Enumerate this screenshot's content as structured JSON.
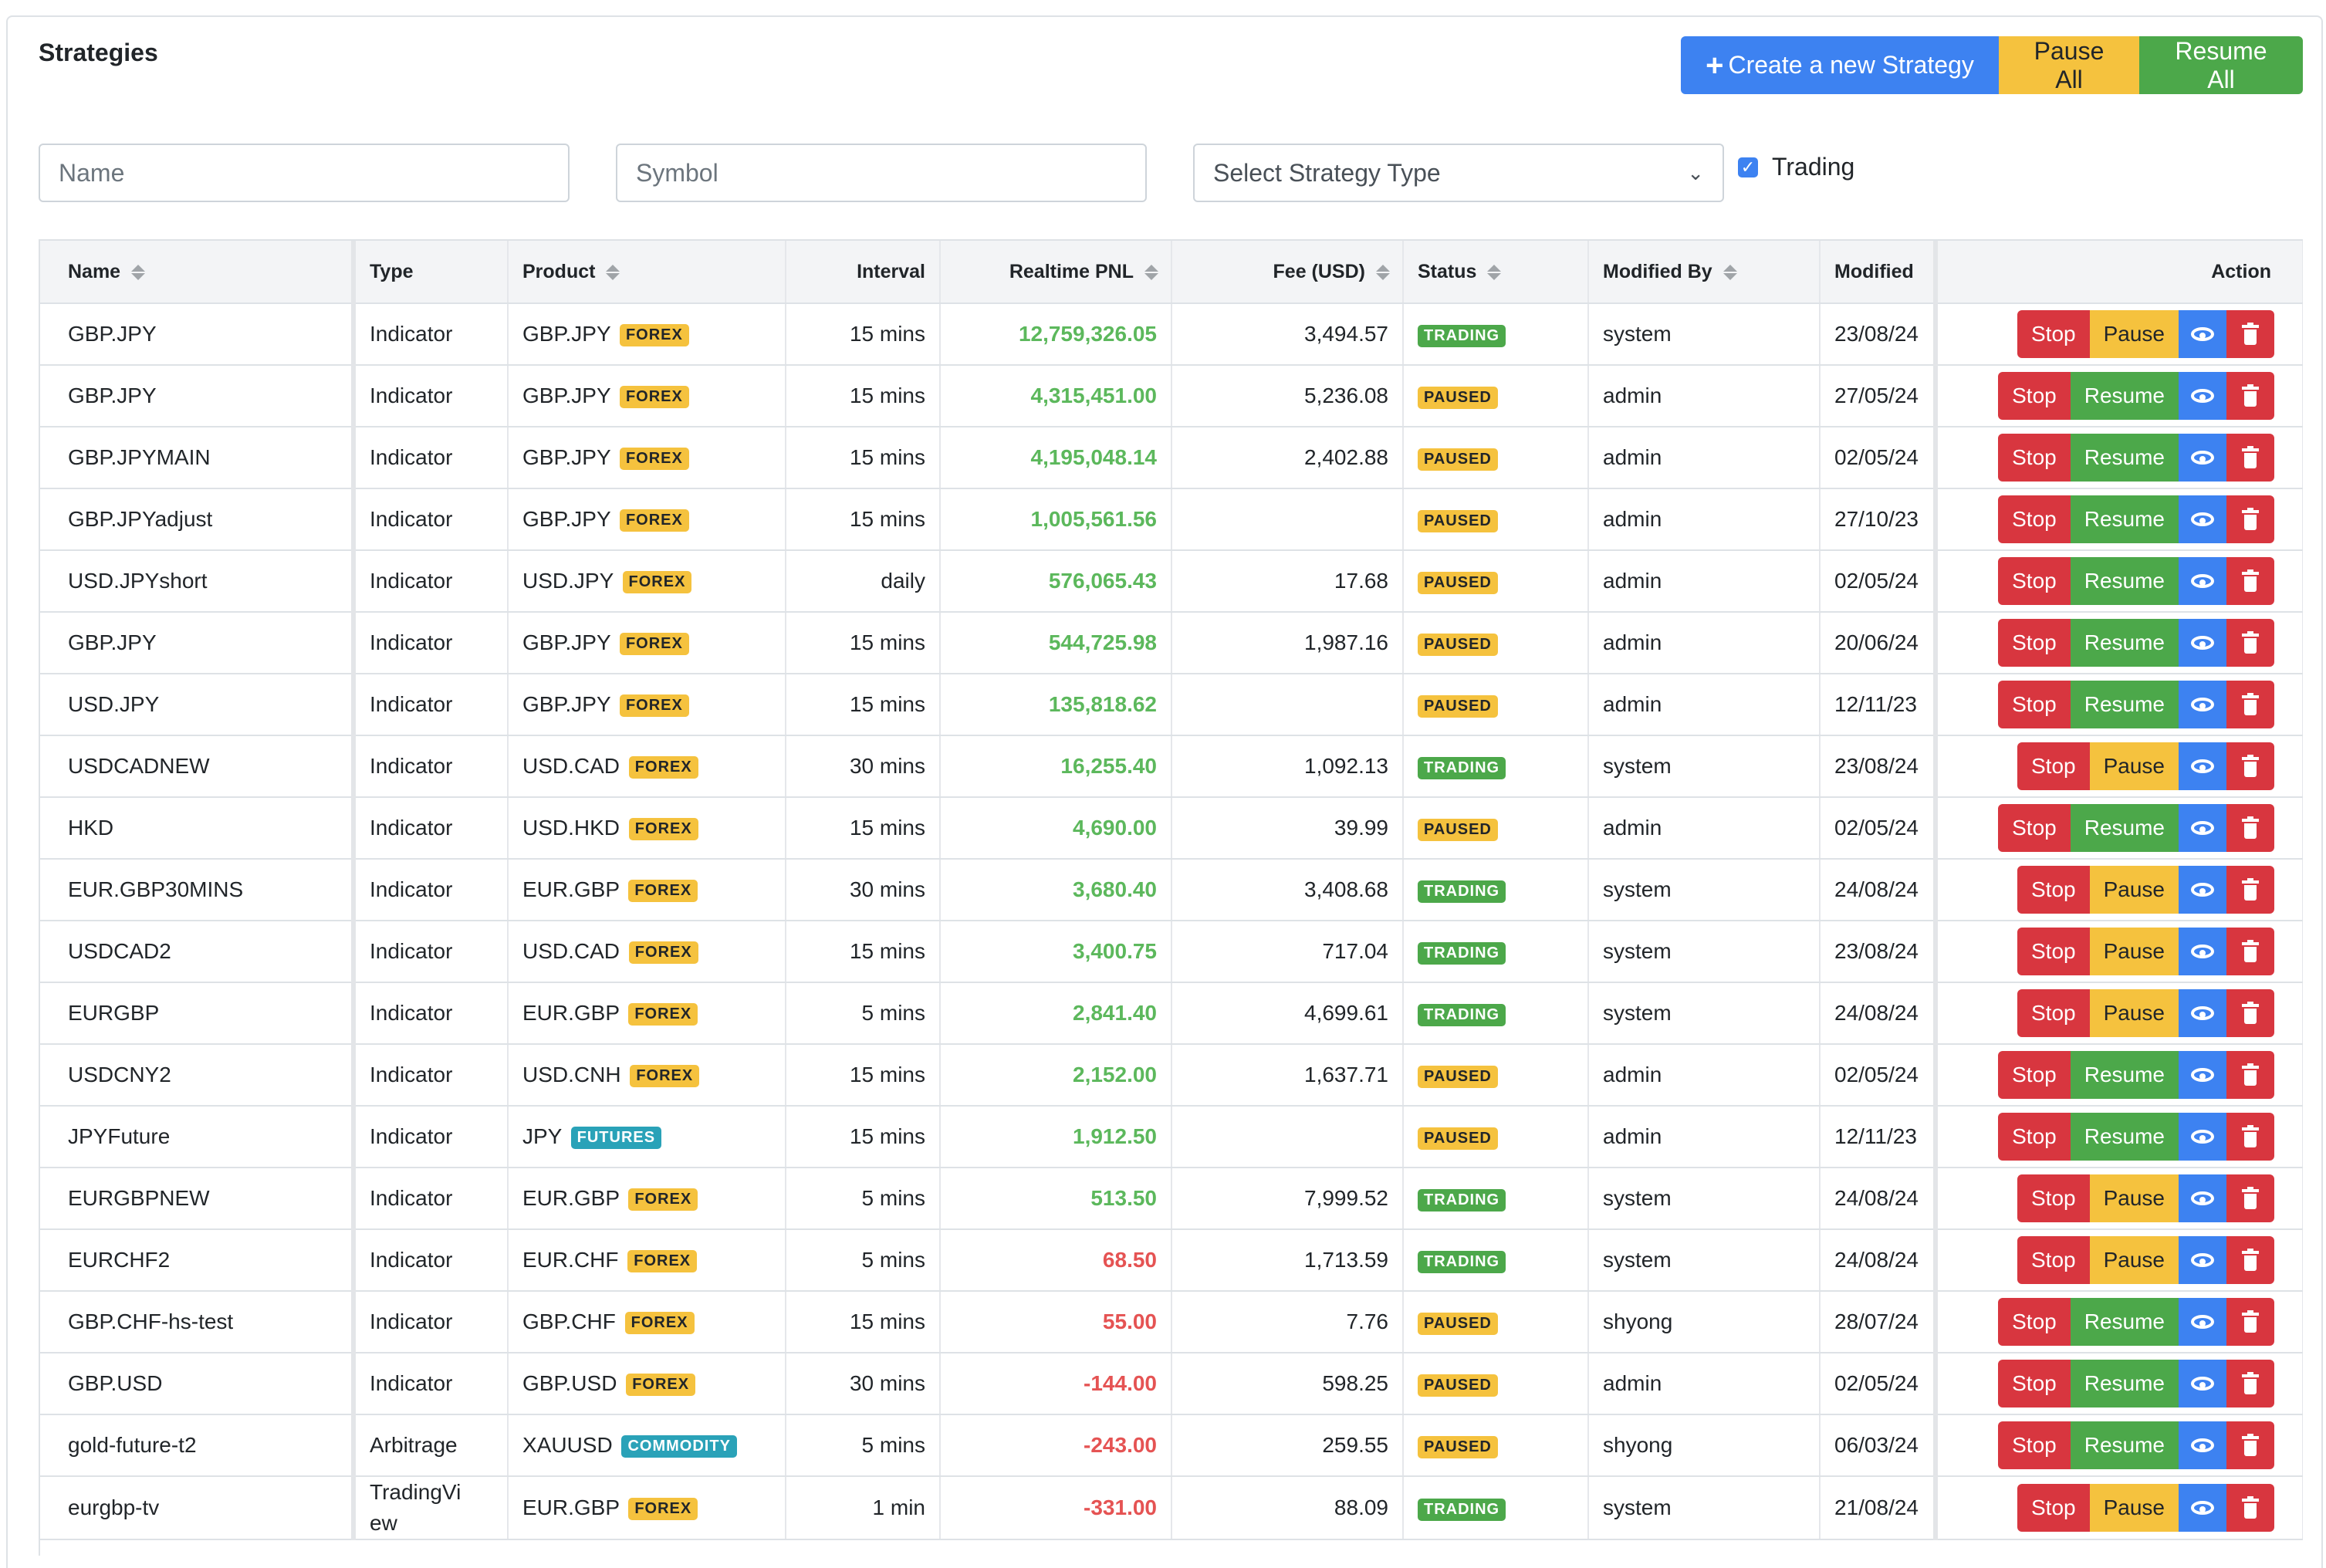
{
  "header": {
    "title": "Strategies",
    "create_label": "Create a new Strategy",
    "pause_all_label": "Pause All",
    "resume_all_label": "Resume All"
  },
  "filters": {
    "name_placeholder": "Name",
    "symbol_placeholder": "Symbol",
    "type_select_label": "Select Strategy Type",
    "trading_label": "Trading",
    "trading_checked": true
  },
  "columns": {
    "name": "Name",
    "type": "Type",
    "product": "Product",
    "interval": "Interval",
    "pnl": "Realtime PNL",
    "fee": "Fee (USD)",
    "status": "Status",
    "modified_by": "Modified By",
    "modified": "Modified",
    "action": "Action"
  },
  "action_labels": {
    "stop": "Stop",
    "pause": "Pause",
    "resume": "Resume"
  },
  "colors": {
    "primary": "#3d82f1",
    "warning": "#f5c23e",
    "success": "#4ca84a",
    "danger": "#d8363f",
    "pnl_positive": "#5cb85c",
    "pnl_negative": "#e55353"
  },
  "rows": [
    {
      "name": "GBP.JPY",
      "type": "Indicator",
      "product": "GBP.JPY",
      "tag": "FOREX",
      "interval": "15 mins",
      "pnl": "12,759,326.05",
      "pnl_sign": "pos",
      "fee": "3,494.57",
      "status": "TRADING",
      "modified_by": "system",
      "modified": "23/08/24"
    },
    {
      "name": "GBP.JPY",
      "type": "Indicator",
      "product": "GBP.JPY",
      "tag": "FOREX",
      "interval": "15 mins",
      "pnl": "4,315,451.00",
      "pnl_sign": "pos",
      "fee": "5,236.08",
      "status": "PAUSED",
      "modified_by": "admin",
      "modified": "27/05/24"
    },
    {
      "name": "GBP.JPYMAIN",
      "type": "Indicator",
      "product": "GBP.JPY",
      "tag": "FOREX",
      "interval": "15 mins",
      "pnl": "4,195,048.14",
      "pnl_sign": "pos",
      "fee": "2,402.88",
      "status": "PAUSED",
      "modified_by": "admin",
      "modified": "02/05/24"
    },
    {
      "name": "GBP.JPYadjust",
      "type": "Indicator",
      "product": "GBP.JPY",
      "tag": "FOREX",
      "interval": "15 mins",
      "pnl": "1,005,561.56",
      "pnl_sign": "pos",
      "fee": "",
      "status": "PAUSED",
      "modified_by": "admin",
      "modified": "27/10/23"
    },
    {
      "name": "USD.JPYshort",
      "type": "Indicator",
      "product": "USD.JPY",
      "tag": "FOREX",
      "interval": "daily",
      "pnl": "576,065.43",
      "pnl_sign": "pos",
      "fee": "17.68",
      "status": "PAUSED",
      "modified_by": "admin",
      "modified": "02/05/24"
    },
    {
      "name": "GBP.JPY",
      "type": "Indicator",
      "product": "GBP.JPY",
      "tag": "FOREX",
      "interval": "15 mins",
      "pnl": "544,725.98",
      "pnl_sign": "pos",
      "fee": "1,987.16",
      "status": "PAUSED",
      "modified_by": "admin",
      "modified": "20/06/24"
    },
    {
      "name": "USD.JPY",
      "type": "Indicator",
      "product": "GBP.JPY",
      "tag": "FOREX",
      "interval": "15 mins",
      "pnl": "135,818.62",
      "pnl_sign": "pos",
      "fee": "",
      "status": "PAUSED",
      "modified_by": "admin",
      "modified": "12/11/23"
    },
    {
      "name": "USDCADNEW",
      "type": "Indicator",
      "product": "USD.CAD",
      "tag": "FOREX",
      "interval": "30 mins",
      "pnl": "16,255.40",
      "pnl_sign": "pos",
      "fee": "1,092.13",
      "status": "TRADING",
      "modified_by": "system",
      "modified": "23/08/24"
    },
    {
      "name": "HKD",
      "type": "Indicator",
      "product": "USD.HKD",
      "tag": "FOREX",
      "interval": "15 mins",
      "pnl": "4,690.00",
      "pnl_sign": "pos",
      "fee": "39.99",
      "status": "PAUSED",
      "modified_by": "admin",
      "modified": "02/05/24"
    },
    {
      "name": "EUR.GBP30MINS",
      "type": "Indicator",
      "product": "EUR.GBP",
      "tag": "FOREX",
      "interval": "30 mins",
      "pnl": "3,680.40",
      "pnl_sign": "pos",
      "fee": "3,408.68",
      "status": "TRADING",
      "modified_by": "system",
      "modified": "24/08/24"
    },
    {
      "name": "USDCAD2",
      "type": "Indicator",
      "product": "USD.CAD",
      "tag": "FOREX",
      "interval": "15 mins",
      "pnl": "3,400.75",
      "pnl_sign": "pos",
      "fee": "717.04",
      "status": "TRADING",
      "modified_by": "system",
      "modified": "23/08/24"
    },
    {
      "name": "EURGBP",
      "type": "Indicator",
      "product": "EUR.GBP",
      "tag": "FOREX",
      "interval": "5 mins",
      "pnl": "2,841.40",
      "pnl_sign": "pos",
      "fee": "4,699.61",
      "status": "TRADING",
      "modified_by": "system",
      "modified": "24/08/24"
    },
    {
      "name": "USDCNY2",
      "type": "Indicator",
      "product": "USD.CNH",
      "tag": "FOREX",
      "interval": "15 mins",
      "pnl": "2,152.00",
      "pnl_sign": "pos",
      "fee": "1,637.71",
      "status": "PAUSED",
      "modified_by": "admin",
      "modified": "02/05/24"
    },
    {
      "name": "JPYFuture",
      "type": "Indicator",
      "product": "JPY",
      "tag": "FUTURES",
      "interval": "15 mins",
      "pnl": "1,912.50",
      "pnl_sign": "pos",
      "fee": "",
      "status": "PAUSED",
      "modified_by": "admin",
      "modified": "12/11/23"
    },
    {
      "name": "EURGBPNEW",
      "type": "Indicator",
      "product": "EUR.GBP",
      "tag": "FOREX",
      "interval": "5 mins",
      "pnl": "513.50",
      "pnl_sign": "pos",
      "fee": "7,999.52",
      "status": "TRADING",
      "modified_by": "system",
      "modified": "24/08/24"
    },
    {
      "name": "EURCHF2",
      "type": "Indicator",
      "product": "EUR.CHF",
      "tag": "FOREX",
      "interval": "5 mins",
      "pnl": "68.50",
      "pnl_sign": "neg",
      "fee": "1,713.59",
      "status": "TRADING",
      "modified_by": "system",
      "modified": "24/08/24"
    },
    {
      "name": "GBP.CHF-hs-test",
      "type": "Indicator",
      "product": "GBP.CHF",
      "tag": "FOREX",
      "interval": "15 mins",
      "pnl": "55.00",
      "pnl_sign": "neg",
      "fee": "7.76",
      "status": "PAUSED",
      "modified_by": "shyong",
      "modified": "28/07/24"
    },
    {
      "name": "GBP.USD",
      "type": "Indicator",
      "product": "GBP.USD",
      "tag": "FOREX",
      "interval": "30 mins",
      "pnl": "-144.00",
      "pnl_sign": "neg",
      "fee": "598.25",
      "status": "PAUSED",
      "modified_by": "admin",
      "modified": "02/05/24"
    },
    {
      "name": "gold-future-t2",
      "type": "Arbitrage",
      "product": "XAUUSD",
      "tag": "COMMODITY",
      "interval": "5 mins",
      "pnl": "-243.00",
      "pnl_sign": "neg",
      "fee": "259.55",
      "status": "PAUSED",
      "modified_by": "shyong",
      "modified": "06/03/24"
    },
    {
      "name": "eurgbp-tv",
      "type": "TradingView",
      "product": "EUR.GBP",
      "tag": "FOREX",
      "interval": "1 min",
      "pnl": "-331.00",
      "pnl_sign": "neg",
      "fee": "88.09",
      "status": "TRADING",
      "modified_by": "system",
      "modified": "21/08/24"
    }
  ]
}
